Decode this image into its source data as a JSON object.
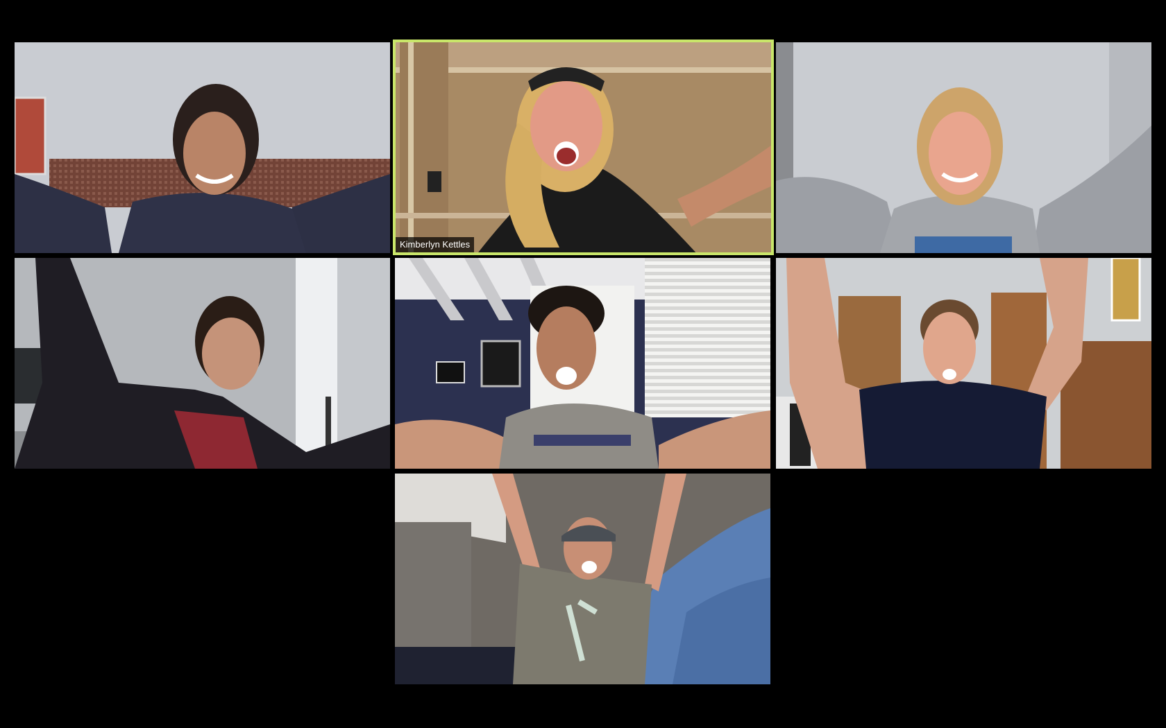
{
  "window": {
    "view_mode": "gallery-view"
  },
  "participants": [
    {
      "id": "p1",
      "name": "",
      "active_speaker": false,
      "mic_icon": "none"
    },
    {
      "id": "p2",
      "name": "Kimberlyn Kettles",
      "active_speaker": true,
      "mic_icon": "none"
    },
    {
      "id": "p3",
      "name": "",
      "active_speaker": false,
      "mic_icon": "none"
    },
    {
      "id": "p4",
      "name": "",
      "active_speaker": false,
      "mic_icon": "none"
    },
    {
      "id": "p5",
      "name": "",
      "active_speaker": false,
      "mic_icon": "none"
    },
    {
      "id": "p6",
      "name": "",
      "active_speaker": false,
      "mic_icon": "none"
    },
    {
      "id": "p7",
      "name": "",
      "active_speaker": false,
      "mic_icon": "none"
    }
  ],
  "colors": {
    "background": "#000000",
    "active_speaker_border": "#c9e66a",
    "name_label_bg": "#000000b8",
    "name_label_text": "#ffffff"
  }
}
